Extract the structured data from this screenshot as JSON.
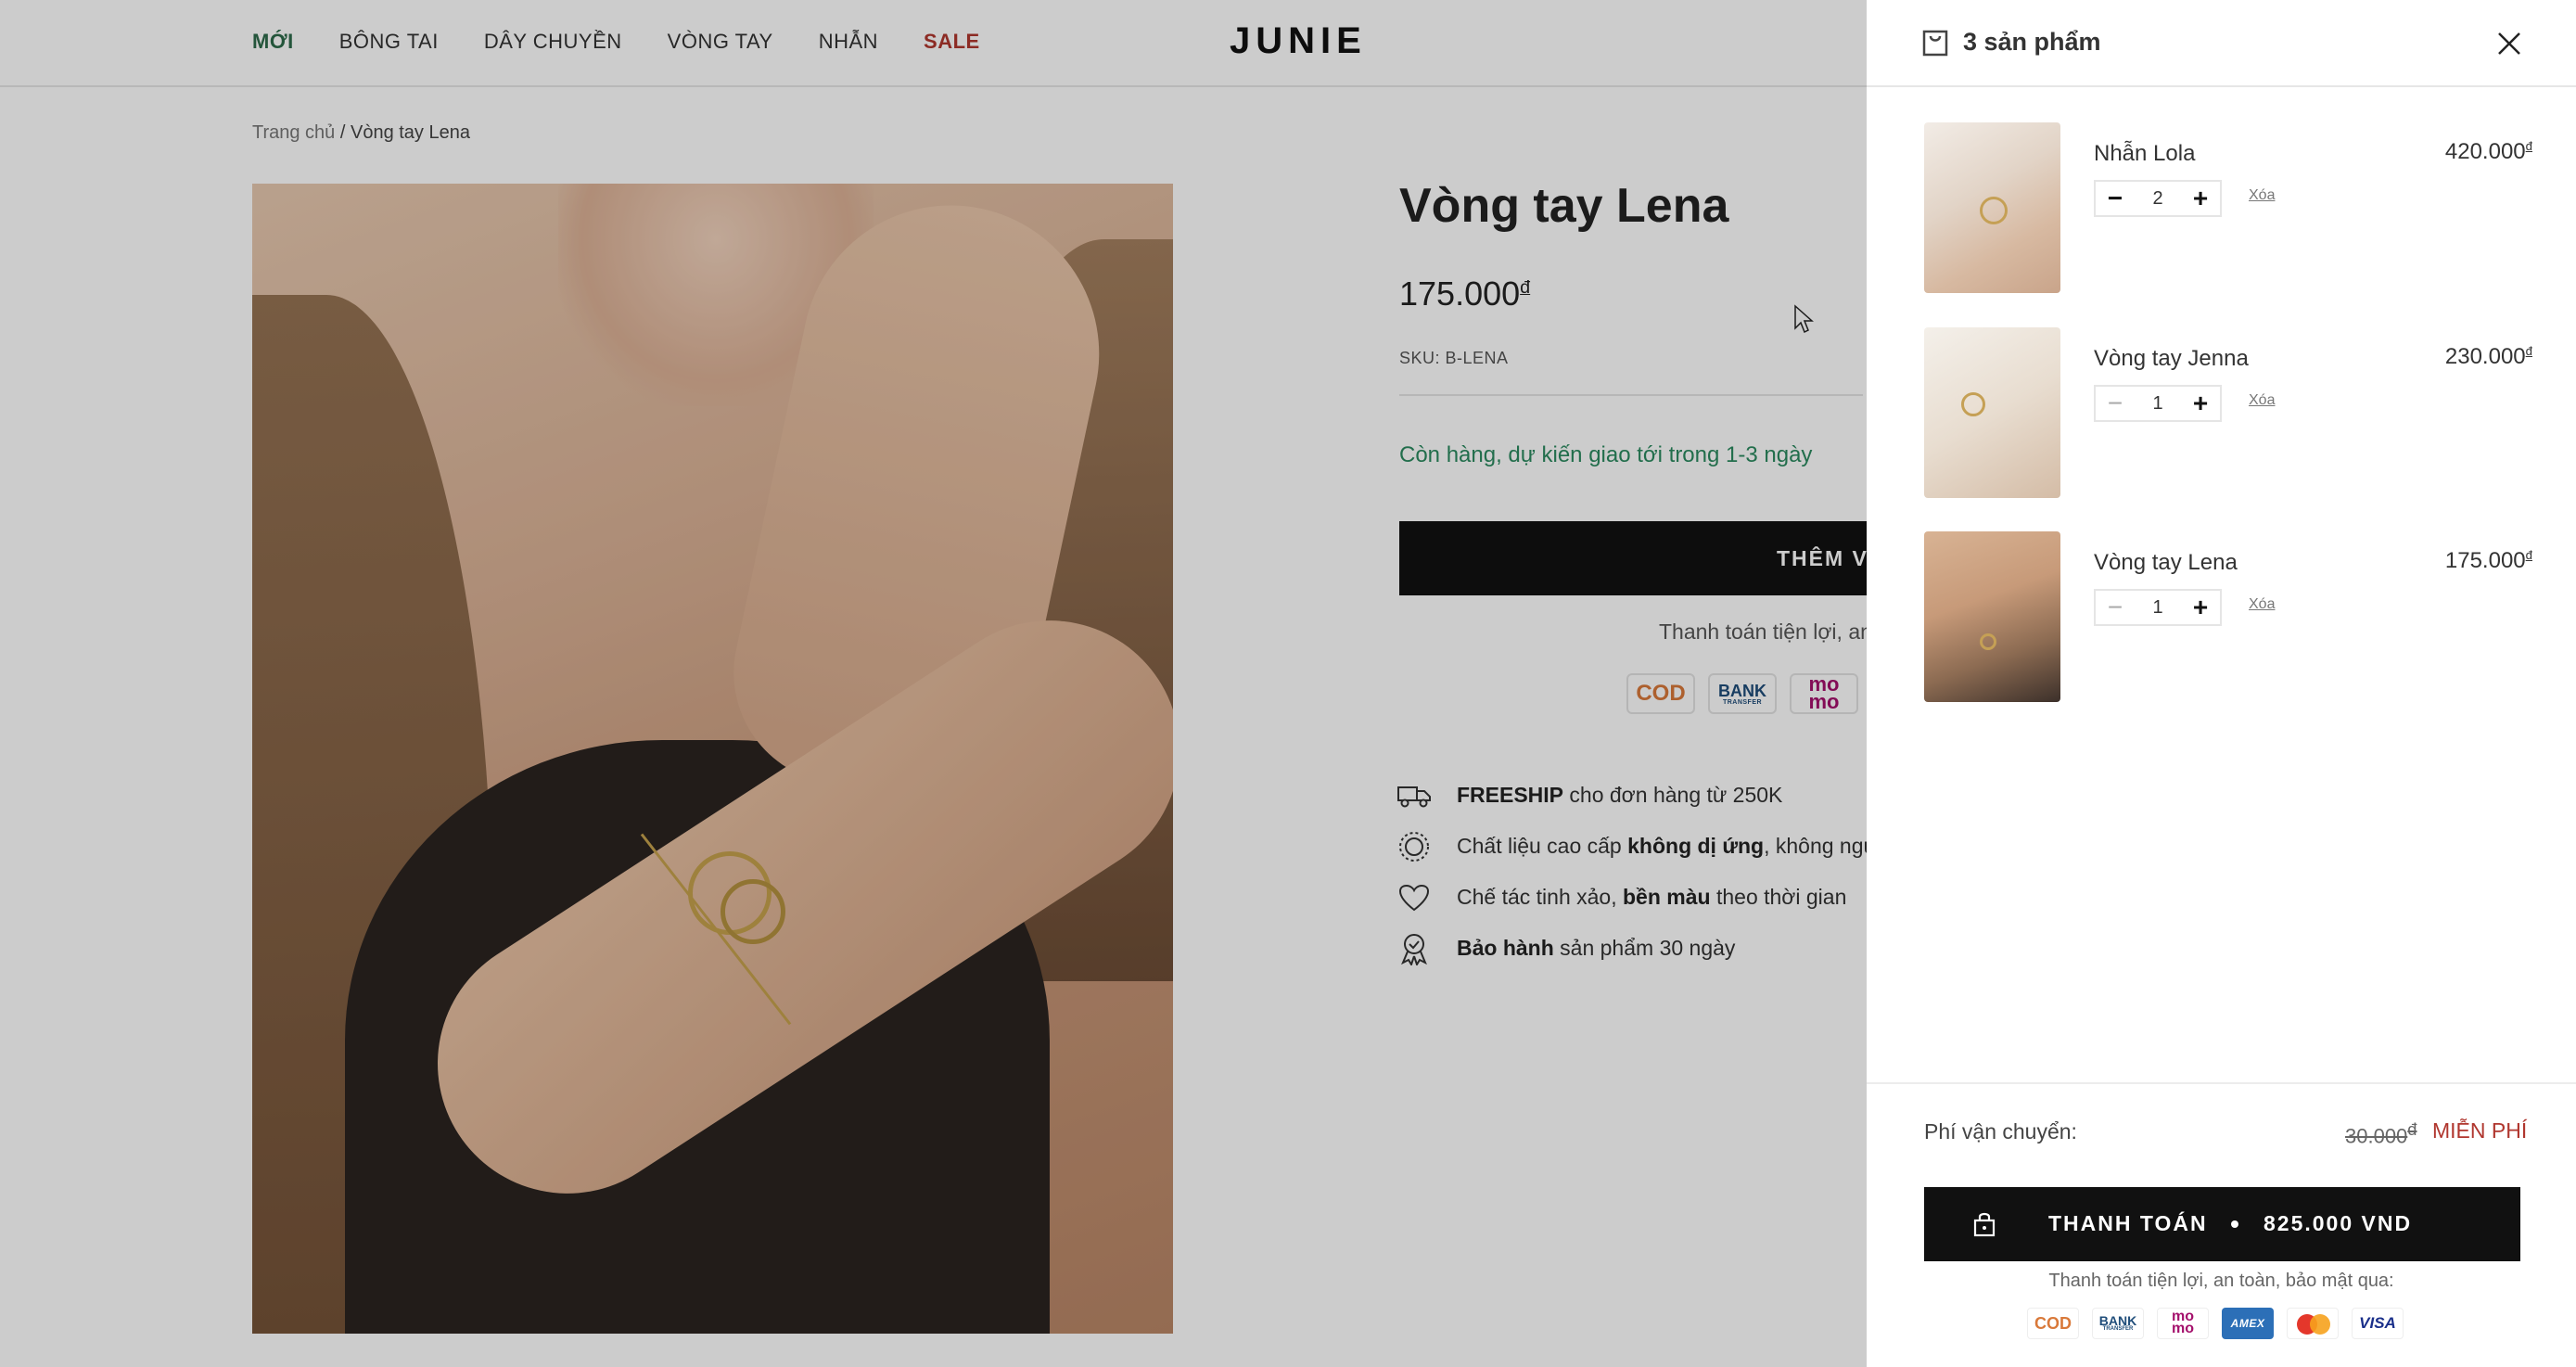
{
  "header": {
    "nav": [
      "MỚI",
      "BÔNG TAI",
      "DÂY CHUYỀN",
      "VÒNG TAY",
      "NHẪN",
      "SALE"
    ],
    "logo": "JUNIE"
  },
  "breadcrumb": {
    "home": "Trang chủ",
    "separator": " / ",
    "current": "Vòng tay Lena"
  },
  "product": {
    "title": "Vòng tay Lena",
    "price": "175.000",
    "currency_symbol": "đ",
    "sku": "SKU: B-LENA",
    "stock": "Còn hàng, dự kiến giao tới trong 1-3 ngày",
    "add_to_cart": "THÊM VÀ",
    "pay_note": "Thanh toán tiện lợi, an",
    "pay_methods": [
      "COD",
      "BANK",
      "TRANSFER",
      "mo",
      "mo"
    ],
    "features": [
      {
        "icon": "truck-icon",
        "bold": "FREESHIP",
        "text": " cho đơn hàng từ 250K"
      },
      {
        "icon": "gem-icon",
        "pre": "Chất liệu cao cấp ",
        "bold": "không dị ứng",
        "text": ", không ngủ"
      },
      {
        "icon": "heart-icon",
        "pre": "Chế tác tinh xảo, ",
        "bold": "bền màu",
        "text": " theo thời gian"
      },
      {
        "icon": "warranty-icon",
        "bold": "Bảo hành",
        "text": " sản phẩm 30 ngày"
      }
    ]
  },
  "cart": {
    "count_label": "3 sản phẩm",
    "remove_label": "Xóa",
    "items": [
      {
        "name": "Nhẫn Lola",
        "price": "420.000",
        "qty": "2"
      },
      {
        "name": "Vòng tay Jenna",
        "price": "230.000",
        "qty": "1"
      },
      {
        "name": "Vòng tay Lena",
        "price": "175.000",
        "qty": "1"
      }
    ],
    "shipping_label": "Phí vận chuyển:",
    "shipping_old": "30.000",
    "shipping_free": "MIỄN PHÍ",
    "checkout_label": "THANH TOÁN",
    "checkout_total": "825.000 VND",
    "pay_note": "Thanh toán tiện lợi, an toàn, bảo mật qua:",
    "pay_methods": [
      "COD",
      "BANK",
      "TRANSFER",
      "mo",
      "mo",
      "AMEX",
      "VISA"
    ]
  },
  "colors": {
    "accent_green": "#2b8a5f",
    "sale_red": "#b0362e",
    "button_black": "#111111"
  }
}
